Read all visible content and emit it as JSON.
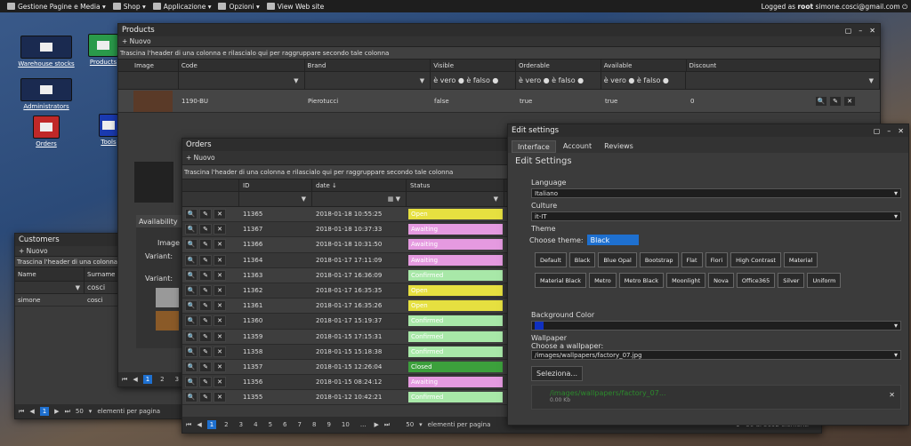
{
  "topbar": {
    "menu": [
      "Gestione Pagine e Media",
      "Shop",
      "Applicazione",
      "Opzioni",
      "View Web site"
    ],
    "logged_prefix": "Logged as",
    "user": "root",
    "email": "simone.cosci@gmail.com"
  },
  "desktop": {
    "warehouse": "Warehouse stocks",
    "products": "Products",
    "administrators": "Administrators",
    "orders": "Orders",
    "tools": "Tools"
  },
  "products": {
    "title": "Products",
    "new_label": "+ Nuovo",
    "group_hint": "Trascina l'header di una colonna e rilascialo qui per raggruppare secondo tale colonna",
    "columns": [
      "Image",
      "Code",
      "Brand",
      "Visible",
      "Orderable",
      "Available",
      "Discount"
    ],
    "bool_filter": "è vero ● è falso ●",
    "row": {
      "code": "1190-BU",
      "brand": "Pierotucci",
      "visible": "false",
      "orderable": "true",
      "available": "true",
      "discount": "0"
    },
    "detail_tab": "Availability",
    "detail_image": "Image",
    "variant1": "Variant:",
    "variant2": "Variant:",
    "pages": [
      "1",
      "2",
      "3"
    ]
  },
  "orders": {
    "title": "Orders",
    "new_label": "+ Nuovo",
    "group_hint": "Trascina l'header di una colonna e rilascialo qui per raggruppare secondo tale colonna",
    "columns": [
      "ID",
      "date ↓",
      "Status"
    ],
    "rows": [
      {
        "id": "11365",
        "date": "2018-01-18 10:55:25",
        "status": "Open"
      },
      {
        "id": "11367",
        "date": "2018-01-18 10:37:33",
        "status": "Awaiting"
      },
      {
        "id": "11366",
        "date": "2018-01-18 10:31:50",
        "status": "Awaiting"
      },
      {
        "id": "11364",
        "date": "2018-01-17 17:11:09",
        "status": "Awaiting"
      },
      {
        "id": "11363",
        "date": "2018-01-17 16:36:09",
        "status": "Confirmed"
      },
      {
        "id": "11362",
        "date": "2018-01-17 16:35:35",
        "status": "Open"
      },
      {
        "id": "11361",
        "date": "2018-01-17 16:35:26",
        "status": "Open"
      },
      {
        "id": "11360",
        "date": "2018-01-17 15:19:37",
        "status": "Confirmed"
      },
      {
        "id": "11359",
        "date": "2018-01-15 17:15:31",
        "status": "Confirmed"
      },
      {
        "id": "11358",
        "date": "2018-01-15 15:18:38",
        "status": "Confirmed"
      },
      {
        "id": "11357",
        "date": "2018-01-15 12:26:04",
        "status": "Closed"
      },
      {
        "id": "11356",
        "date": "2018-01-15 08:24:12",
        "status": "Awaiting"
      },
      {
        "id": "11355",
        "date": "2018-01-12 10:42:21",
        "status": "Confirmed"
      }
    ],
    "pages": [
      "1",
      "2",
      "3",
      "4",
      "5",
      "6",
      "7",
      "8",
      "9",
      "10",
      "..."
    ],
    "page_size": "50",
    "per_page": "elementi per pagina",
    "summary": "1 - 50 di 5692 elementi"
  },
  "customers": {
    "title": "Customers",
    "new_label": "+ Nuovo",
    "group_hint": "Trascina l'header di una colonna",
    "columns": [
      "Name",
      "Surname"
    ],
    "filter_surname": "cosci",
    "row": {
      "name": "simone",
      "surname": "cosci"
    },
    "page": "1",
    "page_size": "50",
    "per_page": "elementi per pagina"
  },
  "settings": {
    "title": "Edit settings",
    "tabs": [
      "Interface",
      "Account",
      "Reviews"
    ],
    "heading": "Edit Settings",
    "language_label": "Language",
    "language": "Italiano",
    "culture_label": "Culture",
    "culture": "it-IT",
    "theme_label": "Theme",
    "choose_theme": "Choose theme:",
    "theme": "Black",
    "themes": [
      "Default",
      "Black",
      "Blue Opal",
      "Bootstrap",
      "Flat",
      "Fiori",
      "High Contrast",
      "Material",
      "Material Black",
      "Metro",
      "Metro Black",
      "Moonlight",
      "Nova",
      "Office365",
      "Silver",
      "Uniform"
    ],
    "bg_label": "Background Color",
    "bg_color": "#1030c0",
    "wallpaper_label": "Wallpaper",
    "choose_wallpaper": "Choose a wallpaper:",
    "wallpaper": "/images/wallpapers/factory_07.jpg",
    "select_btn": "Seleziona...",
    "file_name": "/images/wallpapers/factory_07...",
    "file_size": "0.00 Kb"
  },
  "colors": {
    "open": "#e6e040",
    "awaiting": "#e59ae0",
    "confirmed": "#a8e8a8",
    "closed": "#3ca03c"
  }
}
